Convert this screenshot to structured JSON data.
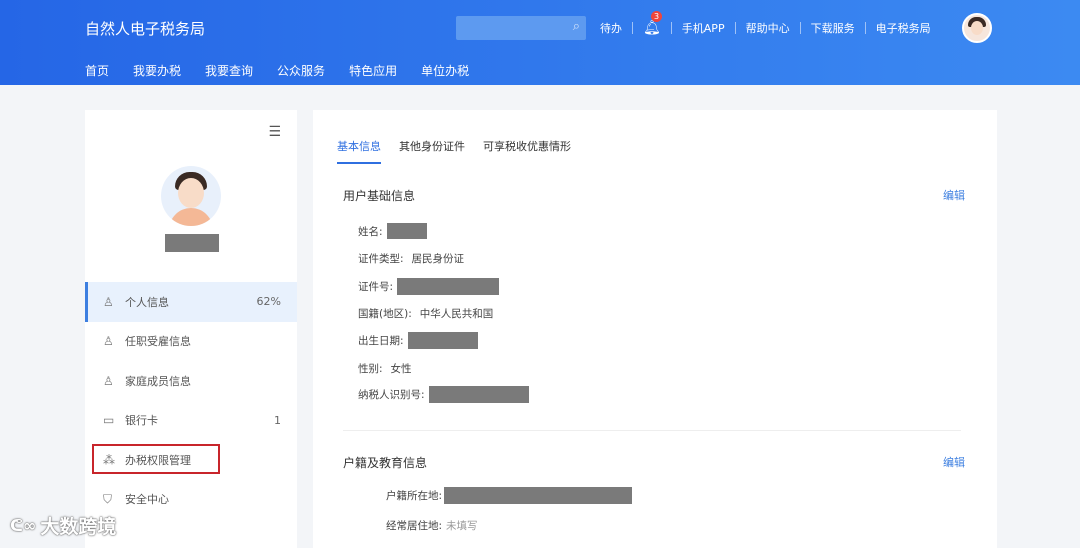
{
  "header": {
    "title": "自然人电子税务局",
    "search_placeholder": "",
    "todo": "待办",
    "notif_count": "3",
    "links": [
      "手机APP",
      "帮助中心",
      "下载服务",
      "电子税务局"
    ]
  },
  "nav": [
    "首页",
    "我要办税",
    "我要查询",
    "公众服务",
    "特色应用",
    "单位办税"
  ],
  "sidebar": {
    "items": [
      {
        "label": "个人信息",
        "count": "62%",
        "icon": "user-icon"
      },
      {
        "label": "任职受雇信息",
        "count": "",
        "icon": "user-card-icon"
      },
      {
        "label": "家庭成员信息",
        "count": "",
        "icon": "users-icon"
      },
      {
        "label": "银行卡",
        "count": "1",
        "icon": "card-icon"
      },
      {
        "label": "办税权限管理",
        "count": "",
        "icon": "org-icon"
      },
      {
        "label": "安全中心",
        "count": "",
        "icon": "shield-icon"
      }
    ]
  },
  "main": {
    "tabs": [
      "基本信息",
      "其他身份证件",
      "可享税收优惠情形"
    ],
    "basic": {
      "title": "用户基础信息",
      "edit": "编辑",
      "fields": [
        {
          "label": "姓名:",
          "value": ""
        },
        {
          "label": "证件类型:",
          "value": "居民身份证"
        },
        {
          "label": "证件号:",
          "value": ""
        },
        {
          "label": "国籍(地区):",
          "value": "中华人民共和国"
        },
        {
          "label": "出生日期:",
          "value": ""
        },
        {
          "label": "性别:",
          "value": "女性"
        },
        {
          "label": "纳税人识别号:",
          "value": ""
        }
      ]
    },
    "household": {
      "title": "户籍及教育信息",
      "edit": "编辑",
      "fields": [
        {
          "label": "户籍所在地:",
          "value": ""
        },
        {
          "label": "经常居住地:",
          "value": "未填写"
        }
      ]
    }
  },
  "watermark": "大数跨境"
}
